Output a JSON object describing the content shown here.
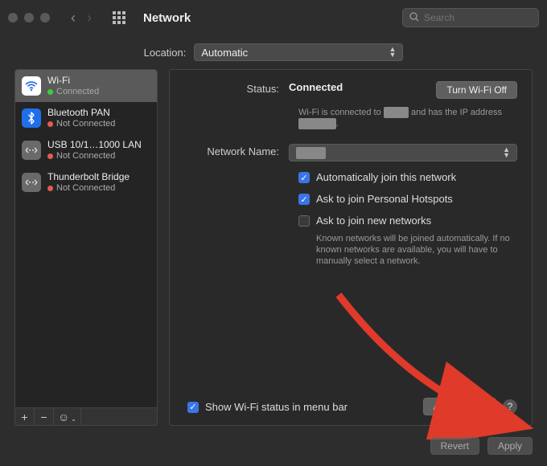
{
  "window": {
    "title": "Network"
  },
  "search": {
    "placeholder": "Search"
  },
  "location": {
    "label": "Location:",
    "value": "Automatic"
  },
  "sidebar": {
    "items": [
      {
        "name": "Wi-Fi",
        "status": "Connected"
      },
      {
        "name": "Bluetooth PAN",
        "status": "Not Connected"
      },
      {
        "name": "USB 10/1…1000 LAN",
        "status": "Not Connected"
      },
      {
        "name": "Thunderbolt Bridge",
        "status": "Not Connected"
      }
    ],
    "footer": {
      "add": "+",
      "remove": "−",
      "menu": "☺︎"
    }
  },
  "panel": {
    "status_label": "Status:",
    "status_value": "Connected",
    "turn_off": "Turn Wi-Fi Off",
    "status_hint_pre": "Wi-Fi is connected to ",
    "status_hint_mid": "████",
    "status_hint_post": " and has the IP address ",
    "status_hint_ip": "██████",
    "network_name_label": "Network Name:",
    "network_name_value": "████",
    "auto_join": "Automatically join this network",
    "ask_hotspot": "Ask to join Personal Hotspots",
    "ask_new": "Ask to join new networks",
    "ask_new_help": "Known networks will be joined automatically. If no known networks are available, you will have to manually select a network.",
    "show_menu": "Show Wi-Fi status in menu bar",
    "advanced": "Advanced…",
    "help": "?"
  },
  "buttons": {
    "revert": "Revert",
    "apply": "Apply"
  }
}
